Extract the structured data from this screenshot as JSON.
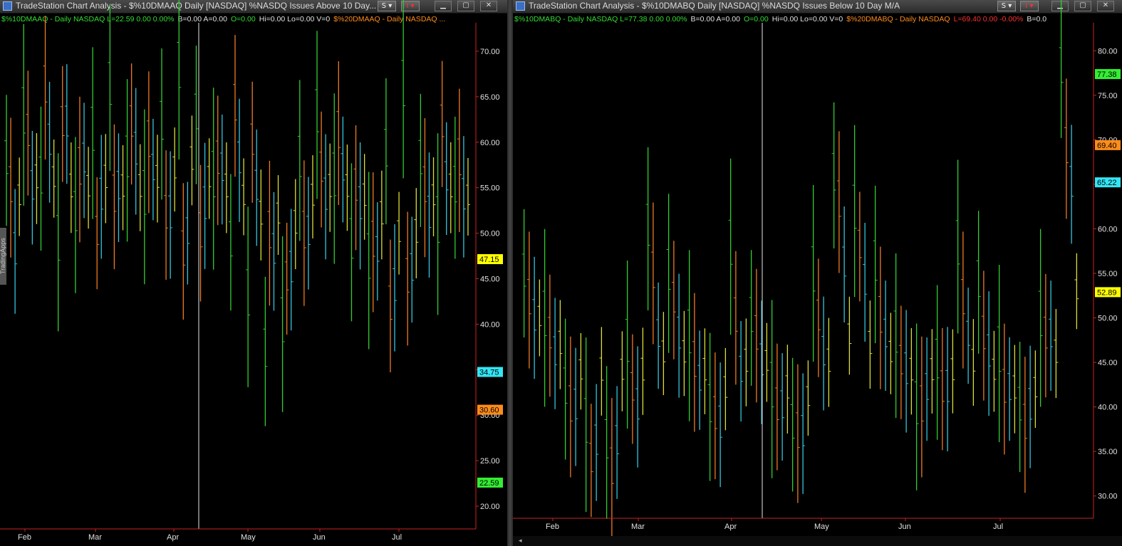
{
  "left": {
    "title": "TradeStation Chart Analysis - $%10DMAAQ Daily [NASDAQ] %NASDQ Issues Above 10 Day...",
    "buttons": [
      "S",
      "I"
    ],
    "status": [
      {
        "text": "$%10DMAAQ - Daily  NASDAQ  L=22.59  0.00  0.00%",
        "color": "#33dd33"
      },
      {
        "text": "B=0.00  A=0.00",
        "color": "#e0e0e0"
      },
      {
        "text": "O=0.00",
        "color": "#33dd33"
      },
      {
        "text": "Hi=0.00  Lo=0.00  V=0",
        "color": "#e0e0e0"
      },
      {
        "text": "$%20DMAAQ - Daily  NASDAQ ...",
        "color": "#ff8c1a"
      }
    ],
    "side_tab": "TradingApps"
  },
  "right": {
    "title": "TradeStation Chart Analysis - $%10DMABQ Daily [NASDAQ] %NASDQ Issues Below 10 Day M/A",
    "buttons": [
      "S",
      "I"
    ],
    "status": [
      {
        "text": "$%10DMABQ - Daily  NASDAQ  L=77.38  0.00  0.00%",
        "color": "#33dd33"
      },
      {
        "text": "B=0.00  A=0.00",
        "color": "#e0e0e0"
      },
      {
        "text": "O=0.00",
        "color": "#33dd33"
      },
      {
        "text": "Hi=0.00  Lo=0.00  V=0",
        "color": "#e0e0e0"
      },
      {
        "text": "$%20DMABQ - Daily  NASDAQ",
        "color": "#ff8c1a"
      },
      {
        "text": "L=69.40  0.00  -0.00%",
        "color": "#ff3030"
      },
      {
        "text": "B=0.0",
        "color": "#e0e0e0"
      }
    ]
  },
  "chart_data": [
    {
      "type": "bar",
      "style": "ohlc",
      "x_ticks": [
        "Feb",
        "Mar",
        "Apr",
        "May",
        "Jun",
        "Jul"
      ],
      "y_ticks": [
        20,
        25,
        30,
        35,
        40,
        45,
        50,
        55,
        60,
        65,
        70
      ],
      "ylim": [
        17.5,
        72.5
      ],
      "grid": false,
      "price_labels": [
        {
          "value": 47.15,
          "color": "#ffff00"
        },
        {
          "value": 34.75,
          "color": "#33e5f5"
        },
        {
          "value": 30.6,
          "color": "#ff8c1a"
        },
        {
          "value": 22.59,
          "color": "#33ee33"
        }
      ],
      "series_colors": [
        "#33cc33",
        "#ee7a22",
        "#33c5dd",
        "#dddd33"
      ],
      "series_cycle": [
        {
          "color": "#33cc33",
          "values": [
            58,
            63,
            56,
            49,
            52,
            61,
            66,
            58,
            54,
            62,
            68,
            63,
            56,
            49,
            43,
            37,
            40,
            58,
            63,
            56,
            49,
            47,
            59,
            66,
            58,
            51,
            55
          ]
        },
        {
          "color": "#ee7a22",
          "values": [
            55,
            61,
            66,
            62,
            57,
            50,
            54,
            62,
            60,
            52,
            48,
            50,
            58,
            64,
            60,
            50,
            45,
            50,
            57,
            61,
            55,
            49,
            42,
            45,
            55,
            62,
            58
          ]
        },
        {
          "color": "#33c5dd",
          "values": [
            48,
            55,
            60,
            62,
            58,
            54,
            55,
            59,
            57,
            52,
            50,
            53,
            57,
            58,
            55,
            48,
            46,
            50,
            54,
            57,
            53,
            48,
            44,
            46,
            52,
            56,
            54
          ]
        },
        {
          "color": "#dddd33",
          "values": [
            54,
            56,
            56,
            55,
            55,
            56,
            55,
            55,
            56,
            57,
            58,
            56,
            55,
            54,
            52,
            52,
            51,
            54,
            55,
            55,
            54,
            52,
            50,
            50,
            54,
            55,
            54
          ]
        }
      ]
    },
    {
      "type": "bar",
      "style": "ohlc",
      "x_ticks": [
        "Feb",
        "Mar",
        "Apr",
        "May",
        "Jun",
        "Jul"
      ],
      "y_ticks": [
        30,
        35,
        40,
        45,
        50,
        55,
        60,
        65,
        70,
        75,
        80
      ],
      "ylim": [
        27.5,
        82.5
      ],
      "grid": false,
      "price_labels": [
        {
          "value": 77.38,
          "color": "#33ee33"
        },
        {
          "value": 69.4,
          "color": "#ff8c1a"
        },
        {
          "value": 65.22,
          "color": "#33e5f5"
        },
        {
          "value": 52.89,
          "color": "#ffff00"
        }
      ],
      "series_colors": [
        "#33cc33",
        "#ee7a22",
        "#33c5dd",
        "#dddd33"
      ],
      "series_cycle": [
        {
          "color": "#33cc33",
          "values": [
            55,
            50,
            42,
            38,
            36,
            47,
            60,
            55,
            48,
            40,
            58,
            50,
            42,
            38,
            55,
            66,
            62,
            56,
            48,
            40,
            45,
            58,
            54,
            46,
            40,
            50,
            78
          ]
        },
        {
          "color": "#ee7a22",
          "values": [
            52,
            48,
            40,
            34,
            33,
            42,
            55,
            52,
            45,
            39,
            50,
            48,
            40,
            37,
            50,
            63,
            58,
            50,
            45,
            40,
            42,
            52,
            48,
            42,
            38,
            48,
            69
          ]
        },
        {
          "color": "#33c5dd",
          "values": [
            50,
            46,
            40,
            36,
            36,
            40,
            48,
            48,
            43,
            38,
            44,
            45,
            40,
            37,
            46,
            56,
            54,
            48,
            44,
            42,
            42,
            48,
            46,
            42,
            40,
            48,
            65
          ]
        },
        {
          "color": "#dddd33",
          "values": [
            50,
            47,
            44,
            44,
            44,
            44,
            46,
            46,
            44,
            42,
            45,
            45,
            42,
            41,
            45,
            48,
            47,
            46,
            44,
            44,
            44,
            45,
            44,
            42,
            42,
            46,
            53
          ]
        }
      ]
    }
  ]
}
